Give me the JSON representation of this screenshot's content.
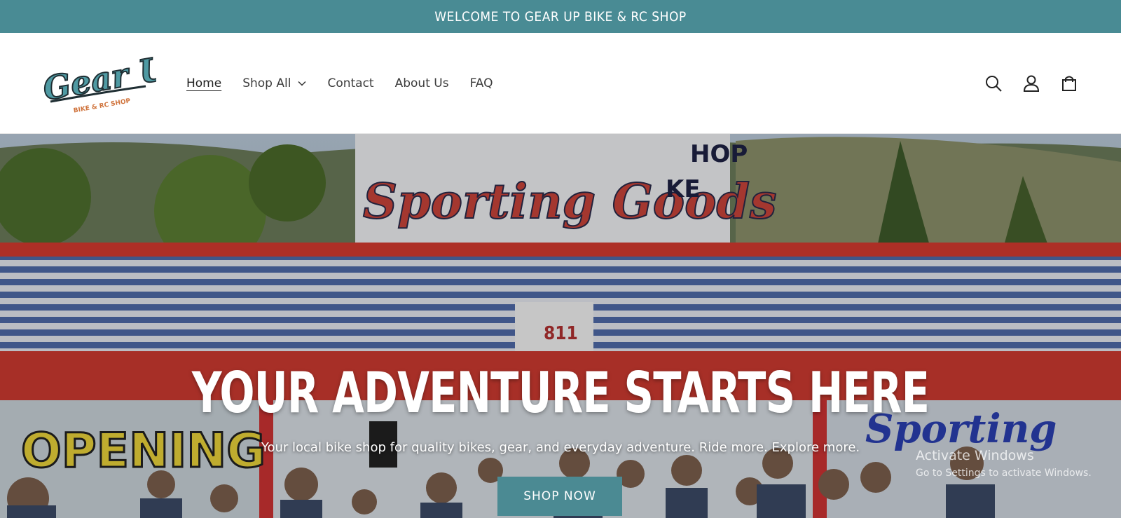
{
  "announcement": {
    "text": "WELCOME TO GEAR UP BIKE & RC SHOP"
  },
  "logo": {
    "main": "Gear Up",
    "sub": "BIKE & RC SHOP"
  },
  "nav": {
    "items": [
      {
        "label": "Home",
        "active": true
      },
      {
        "label": "Shop All",
        "has_dropdown": true
      },
      {
        "label": "Contact"
      },
      {
        "label": "About Us"
      },
      {
        "label": "FAQ"
      }
    ]
  },
  "header_icons": [
    "search-icon",
    "account-icon",
    "cart-icon"
  ],
  "hero": {
    "title": "YOUR ADVENTURE STARTS HERE",
    "subtitle": "Your local bike shop for quality bikes, gear, and everyday adventure. Ride more. Explore more.",
    "cta_label": "SHOP NOW",
    "image_text": {
      "sign": "Sporting Goods",
      "side_sign_left": "KE",
      "side_sign_right": "HOP",
      "address": "811",
      "window_left": "OPENING",
      "window_right": "Sporting"
    }
  },
  "watermark": {
    "line1": "Activate Windows",
    "line2": "Go to Settings to activate Windows."
  },
  "colors": {
    "brand_teal": "#498b94",
    "button_teal": "#4b8a93",
    "logo_orange": "#d0743d"
  }
}
